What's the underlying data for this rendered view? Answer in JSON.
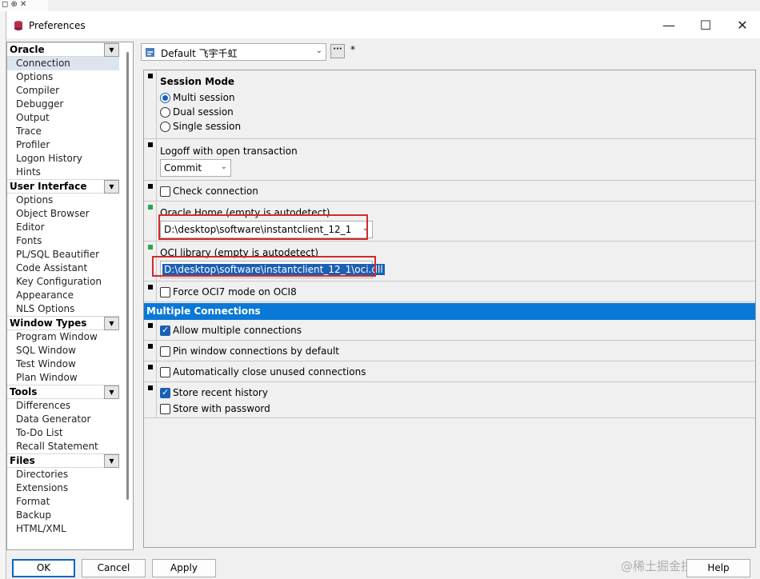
{
  "window": {
    "title": "Preferences",
    "controls": {
      "minimize": "—",
      "maximize": "☐",
      "close": "✕"
    }
  },
  "nav": {
    "groups": [
      {
        "label": "Oracle",
        "items": [
          "Connection",
          "Options",
          "Compiler",
          "Debugger",
          "Output",
          "Trace",
          "Profiler",
          "Logon History",
          "Hints"
        ]
      },
      {
        "label": "User Interface",
        "items": [
          "Options",
          "Object Browser",
          "Editor",
          "Fonts",
          "PL/SQL Beautifier",
          "Code Assistant",
          "Key Configuration",
          "Appearance",
          "NLS Options"
        ]
      },
      {
        "label": "Window Types",
        "items": [
          "Program Window",
          "SQL Window",
          "Test Window",
          "Plan Window"
        ]
      },
      {
        "label": "Tools",
        "items": [
          "Differences",
          "Data Generator",
          "To-Do List",
          "Recall Statement"
        ]
      },
      {
        "label": "Files",
        "items": [
          "Directories",
          "Extensions",
          "Format",
          "Backup",
          "HTML/XML"
        ]
      }
    ],
    "selected": "Connection"
  },
  "profile": {
    "value": "Default 飞宇千虹",
    "more_label": "···",
    "modified_marker": "*"
  },
  "session_mode": {
    "title": "Session Mode",
    "options": [
      "Multi session",
      "Dual session",
      "Single session"
    ],
    "selected": "Multi session"
  },
  "logoff": {
    "label": "Logoff with open transaction",
    "value": "Commit"
  },
  "check_connection": {
    "label": "Check connection",
    "checked": false
  },
  "oracle_home": {
    "label": "Oracle Home (empty is autodetect)",
    "value": "D:\\desktop\\software\\instantclient_12_1"
  },
  "oci_library": {
    "label": "OCI library (empty is autodetect)",
    "value": "D:\\desktop\\software\\instantclient_12_1\\oci.dll"
  },
  "force_oci7": {
    "label": "Force OCI7 mode on OCI8",
    "checked": false
  },
  "multiple_connections": {
    "title": "Multiple Connections",
    "allow": {
      "label": "Allow multiple connections",
      "checked": true
    },
    "pin": {
      "label": "Pin window connections by default",
      "checked": false
    },
    "auto_close": {
      "label": "Automatically close unused connections",
      "checked": false
    },
    "store_history": {
      "label": "Store recent history",
      "checked": true
    },
    "store_password": {
      "label": "Store with password",
      "checked": false
    }
  },
  "buttons": {
    "ok": "OK",
    "cancel": "Cancel",
    "apply": "Apply",
    "help": "Help"
  },
  "watermark": "@稀土掘金技术社区",
  "colors": {
    "accent": "#0a78d7",
    "highlight_border": "#d42a2a",
    "marker_green": "#2aa64a"
  }
}
